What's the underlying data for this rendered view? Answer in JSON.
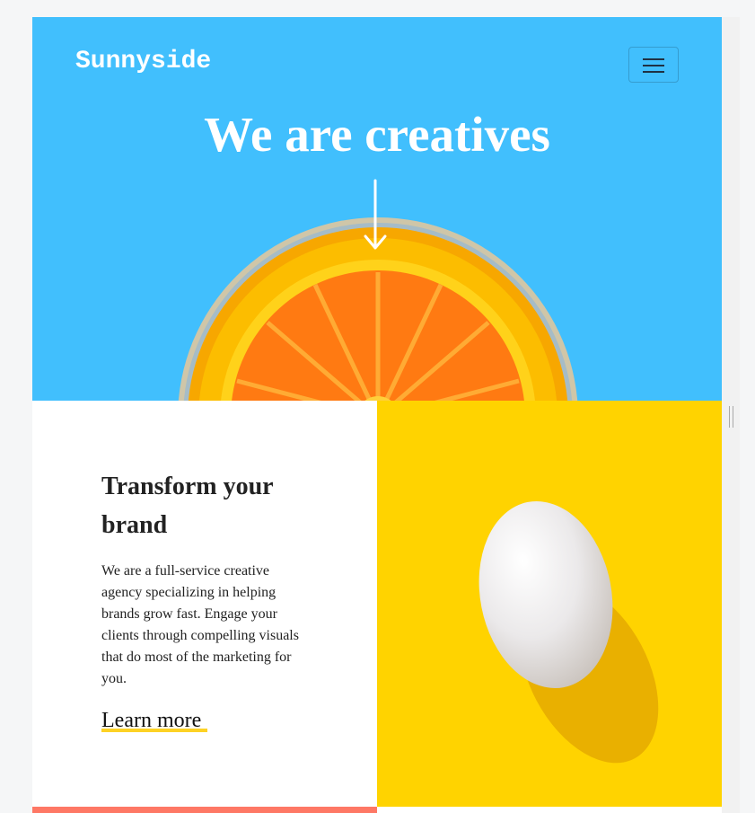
{
  "colors": {
    "hero_background": "#41bffd",
    "egg_background": "#ffd300",
    "underline_accent": "#fdd225",
    "coral_accent": "#fe7865"
  },
  "header": {
    "logo": "Sunnyside",
    "menu_toggle_icon": "hamburger-icon"
  },
  "hero": {
    "title": "We are creatives",
    "scroll_icon": "arrow-down-icon"
  },
  "transform": {
    "heading": "Transform your brand",
    "body": "We are a full-service creative agency specializing in helping brands grow fast. Engage your clients through compelling visuals that do most of the marketing for you.",
    "link": "Learn more"
  }
}
